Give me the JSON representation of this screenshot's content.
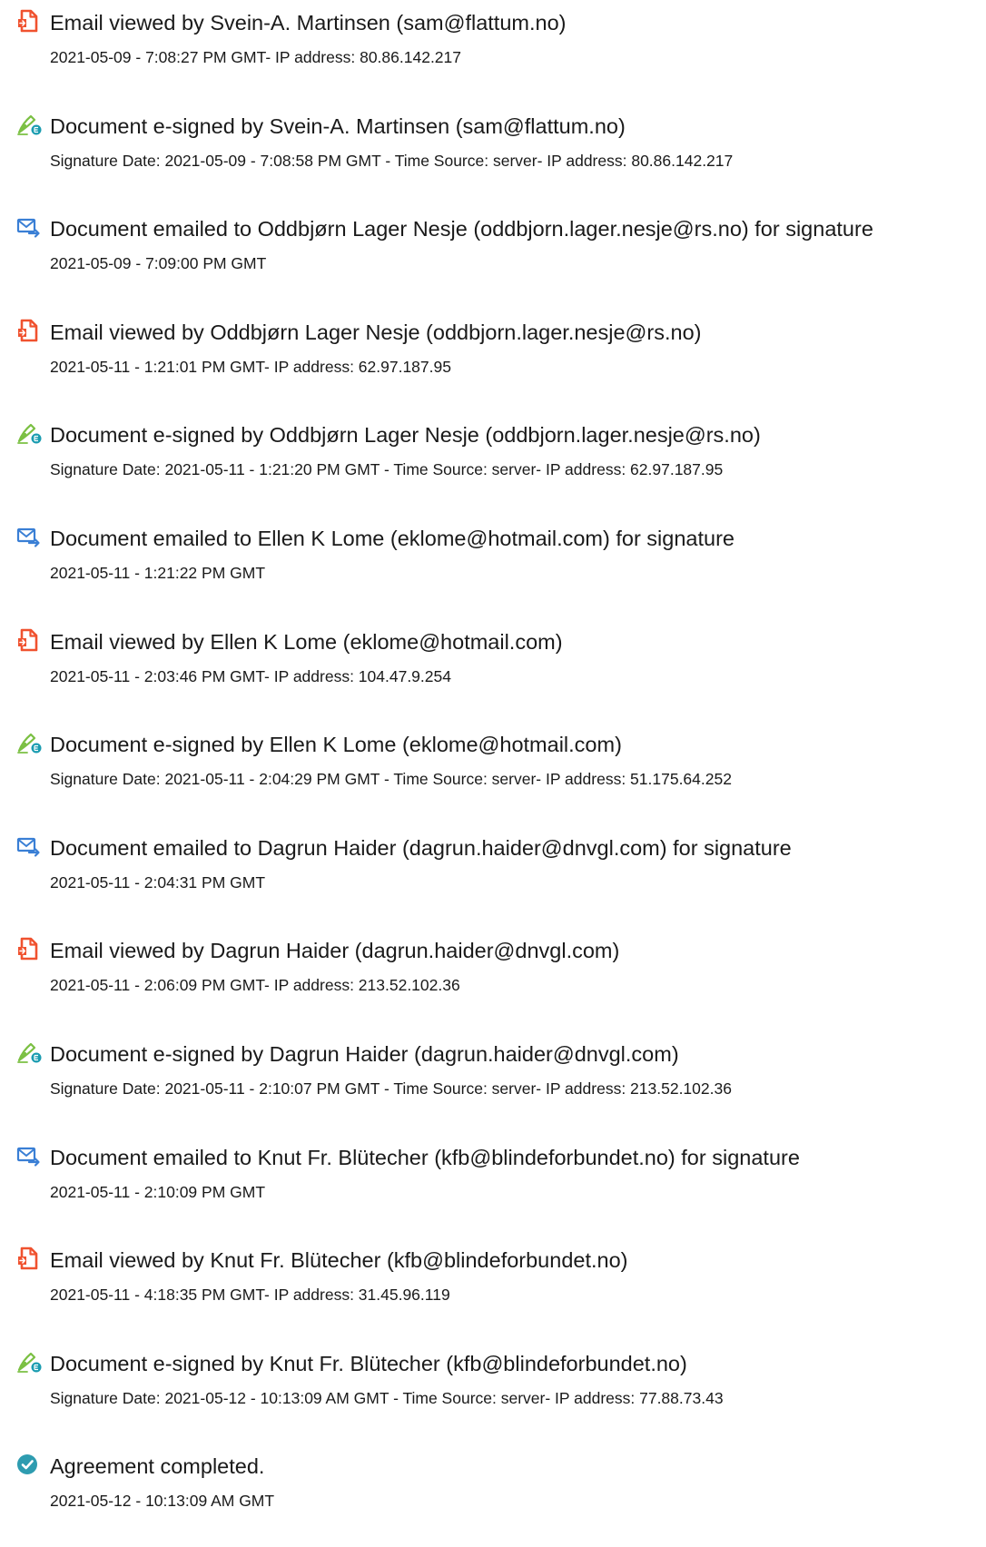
{
  "colors": {
    "viewed_icon": "#f0522f",
    "signed_pen": "#7bc043",
    "signed_badge": "#1a9cb0",
    "emailed_icon": "#3a7fd5",
    "completed_icon": "#2e9cb0"
  },
  "events": [
    {
      "type": "viewed",
      "icon": "document-viewed-icon",
      "title": "Email viewed by Svein-A. Martinsen (sam@flattum.no)",
      "detail": "2021-05-09 - 7:08:27 PM GMT- IP address: 80.86.142.217"
    },
    {
      "type": "signed",
      "icon": "e-sign-pen-icon",
      "title": "Document e-signed by Svein-A. Martinsen (sam@flattum.no)",
      "detail": "Signature Date: 2021-05-09 - 7:08:58 PM GMT - Time Source: server- IP address: 80.86.142.217"
    },
    {
      "type": "emailed",
      "icon": "email-sent-icon",
      "title": "Document emailed to Oddbjørn Lager Nesje (oddbjorn.lager.nesje@rs.no) for signature",
      "detail": "2021-05-09 - 7:09:00 PM GMT"
    },
    {
      "type": "viewed",
      "icon": "document-viewed-icon",
      "title": "Email viewed by Oddbjørn Lager Nesje (oddbjorn.lager.nesje@rs.no)",
      "detail": "2021-05-11 - 1:21:01 PM GMT- IP address: 62.97.187.95"
    },
    {
      "type": "signed",
      "icon": "e-sign-pen-icon",
      "title": "Document e-signed by Oddbjørn Lager Nesje (oddbjorn.lager.nesje@rs.no)",
      "detail": "Signature Date: 2021-05-11 - 1:21:20 PM GMT - Time Source: server- IP address: 62.97.187.95"
    },
    {
      "type": "emailed",
      "icon": "email-sent-icon",
      "title": "Document emailed to Ellen K Lome (eklome@hotmail.com) for signature",
      "detail": "2021-05-11 - 1:21:22 PM GMT"
    },
    {
      "type": "viewed",
      "icon": "document-viewed-icon",
      "title": "Email viewed by Ellen K Lome (eklome@hotmail.com)",
      "detail": "2021-05-11 - 2:03:46 PM GMT- IP address: 104.47.9.254"
    },
    {
      "type": "signed",
      "icon": "e-sign-pen-icon",
      "title": "Document e-signed by Ellen K Lome (eklome@hotmail.com)",
      "detail": "Signature Date: 2021-05-11 - 2:04:29 PM GMT - Time Source: server- IP address: 51.175.64.252"
    },
    {
      "type": "emailed",
      "icon": "email-sent-icon",
      "title": "Document emailed to Dagrun Haider (dagrun.haider@dnvgl.com) for signature",
      "detail": "2021-05-11 - 2:04:31 PM GMT"
    },
    {
      "type": "viewed",
      "icon": "document-viewed-icon",
      "title": "Email viewed by Dagrun Haider (dagrun.haider@dnvgl.com)",
      "detail": "2021-05-11 - 2:06:09 PM GMT- IP address: 213.52.102.36"
    },
    {
      "type": "signed",
      "icon": "e-sign-pen-icon",
      "title": "Document e-signed by Dagrun Haider (dagrun.haider@dnvgl.com)",
      "detail": "Signature Date: 2021-05-11 - 2:10:07 PM GMT - Time Source: server- IP address: 213.52.102.36"
    },
    {
      "type": "emailed",
      "icon": "email-sent-icon",
      "title": "Document emailed to Knut Fr. Blütecher (kfb@blindeforbundet.no) for signature",
      "detail": "2021-05-11 - 2:10:09 PM GMT"
    },
    {
      "type": "viewed",
      "icon": "document-viewed-icon",
      "title": "Email viewed by Knut Fr. Blütecher (kfb@blindeforbundet.no)",
      "detail": "2021-05-11 - 4:18:35 PM GMT- IP address: 31.45.96.119"
    },
    {
      "type": "signed",
      "icon": "e-sign-pen-icon",
      "title": "Document e-signed by Knut Fr. Blütecher (kfb@blindeforbundet.no)",
      "detail": "Signature Date: 2021-05-12 - 10:13:09 AM GMT - Time Source: server- IP address: 77.88.73.43"
    },
    {
      "type": "completed",
      "icon": "check-circle-icon",
      "title": "Agreement completed.",
      "detail": "2021-05-12 - 10:13:09 AM GMT"
    }
  ]
}
